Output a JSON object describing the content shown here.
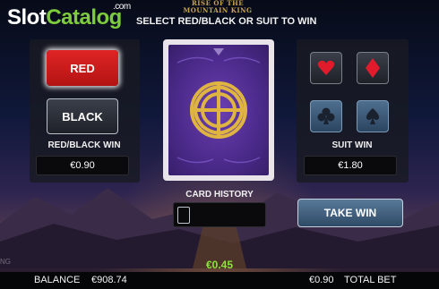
{
  "watermark": {
    "slot": "Slot",
    "catalog": "Catalog",
    "com": ".com"
  },
  "game_title": {
    "line1": "RISE OF THE",
    "line2": "MOUNTAIN KING"
  },
  "instruction": "SELECT RED/BLACK OR SUIT TO WIN",
  "left_panel": {
    "red_label": "RED",
    "black_label": "BLACK",
    "win_label": "RED/BLACK WIN",
    "win_value": "€0.90"
  },
  "right_panel": {
    "suits": [
      {
        "name": "hearts",
        "color": "#e11b2b"
      },
      {
        "name": "diamonds",
        "color": "#e11b2b"
      },
      {
        "name": "clubs",
        "color": "#1a2230"
      },
      {
        "name": "spades",
        "color": "#1a2230"
      }
    ],
    "win_label": "SUIT WIN",
    "win_value": "€1.80"
  },
  "history": {
    "label": "CARD HISTORY"
  },
  "take_win_label": "TAKE WIN",
  "current_win": "€0.45",
  "bottom": {
    "balance_label": "BALANCE",
    "balance_value": "€908.74",
    "bet_value": "€0.90",
    "bet_label": "TOTAL BET",
    "faint_text": "NG"
  },
  "colors": {
    "accent_green": "#8fe33a",
    "red_button": "#d11f1f",
    "card_back": "#4b2a8a",
    "card_ornament": "#e0b441"
  }
}
